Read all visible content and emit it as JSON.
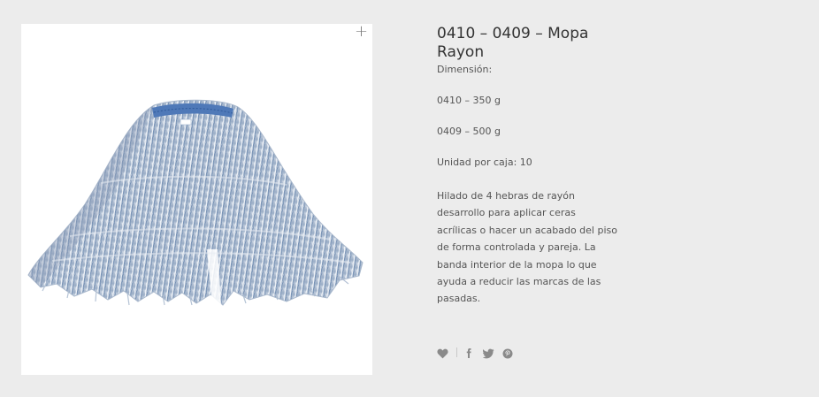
{
  "product": {
    "title": "0410 – 0409 – Mopa Rayon",
    "dimension_label": "Dimensión:",
    "variant_1": "0410 – 350 g",
    "variant_2": "0409 – 500 g",
    "units_per_box": "Unidad por caja: 10",
    "description": "Hilado de 4 hebras de rayón desarrollo para aplicar ceras acrílicas o hacer un acabado del piso de forma controlada y pareja. La banda interior de la mopa lo que ayuda a reducir las marcas de las pasadas."
  },
  "image": {
    "zoom_icon": "plus-icon",
    "band_color": "#4f79b8",
    "strand_color_light": "#dfe6ef",
    "strand_color_blue": "#8aa3c4"
  },
  "share": {
    "icons": [
      "heart-icon",
      "facebook-icon",
      "twitter-icon",
      "pinterest-icon"
    ],
    "icon_color": "#8a8a8a"
  },
  "colors": {
    "page_background": "#ececec",
    "card_background": "#ffffff",
    "title": "#333333",
    "text": "#555555"
  }
}
